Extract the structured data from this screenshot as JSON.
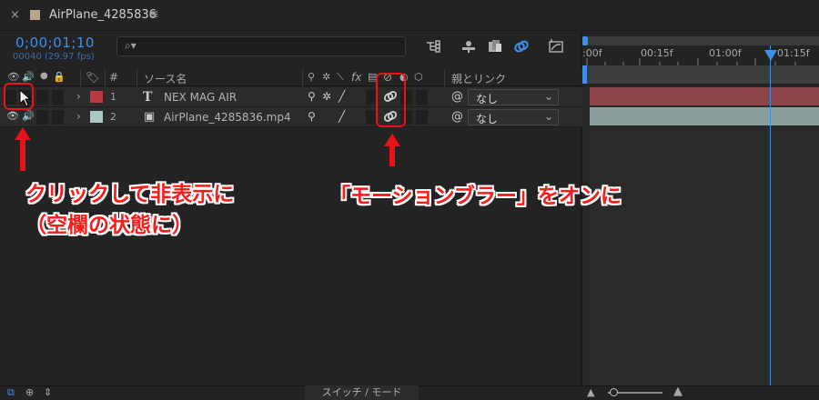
{
  "tab": {
    "close": "×",
    "title": "AirPlane_4285836",
    "menu": "≡"
  },
  "header": {
    "timecode": "0;00;01;10",
    "frame_info": "00040 (29.97 fps)",
    "search_placeholder": "⌕▾"
  },
  "ruler": {
    "labels": [
      ":00f",
      "00:15f",
      "01:00f",
      "01:15f"
    ]
  },
  "columns": {
    "num": "#",
    "source_name": "ソース名",
    "fx": "fx",
    "parent_link": "親とリンク"
  },
  "layers": [
    {
      "num": "1",
      "name": "NEX MAG AIR",
      "type_icon": "T",
      "label_color": "#b8393e",
      "parent": "なし"
    },
    {
      "num": "2",
      "name": "AirPlane_4285836.mp4",
      "type_icon": "▣",
      "label_color": "#a9c7c4",
      "parent": "なし"
    }
  ],
  "bottom": {
    "switch_mode": "スイッチ / モード"
  },
  "annotations": {
    "left_line1": "クリックして非表示に",
    "left_line2": "（空欄の状態に）",
    "right": "「モーションブラー」をオンに"
  },
  "colors": {
    "accent": "#3f8ee8",
    "annotation": "#e8131a"
  }
}
